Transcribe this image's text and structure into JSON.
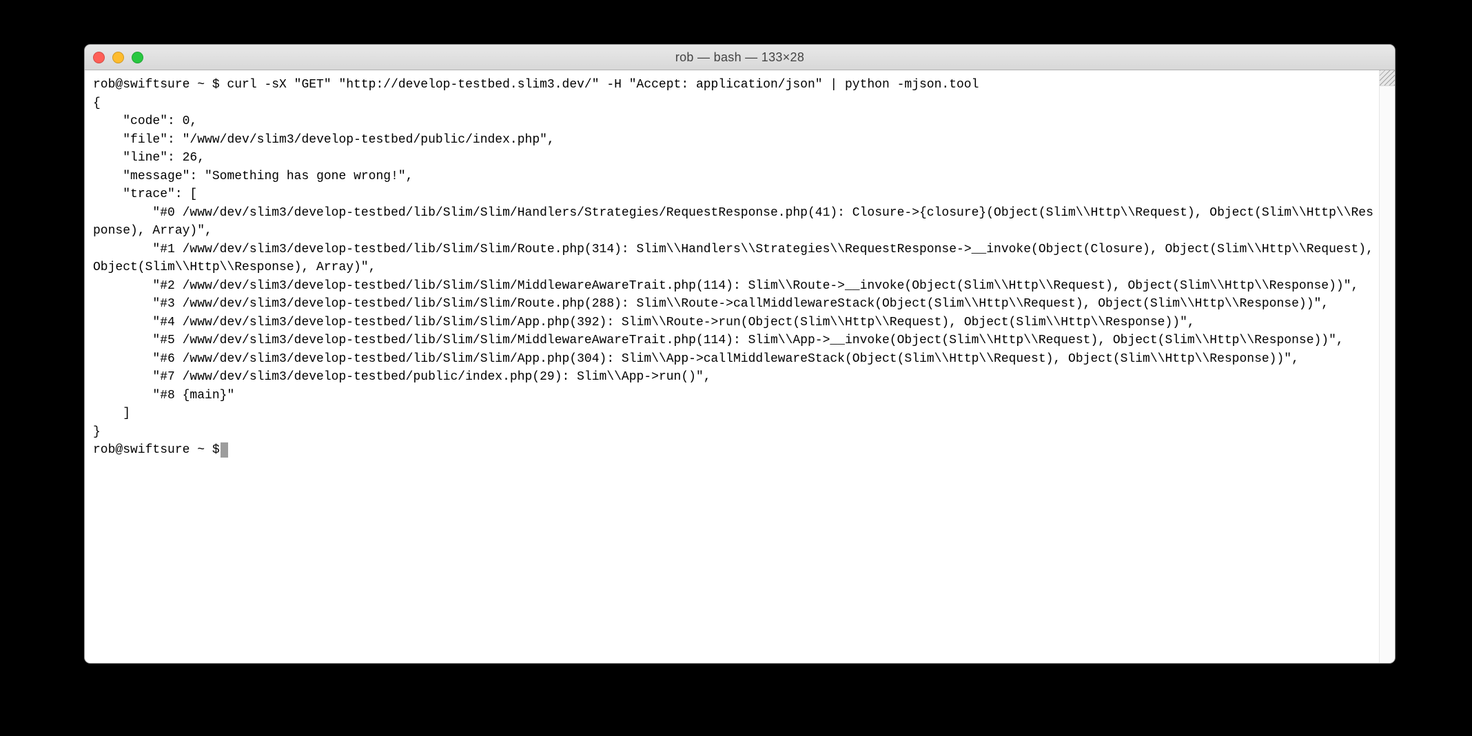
{
  "window": {
    "title": "rob — bash — 133×28"
  },
  "terminal": {
    "prompt1": "rob@swiftsure ~ $ curl -sX \"GET\" \"http://develop-testbed.slim3.dev/\" -H \"Accept: application/json\" | python -mjson.tool",
    "output": "{\n    \"code\": 0,\n    \"file\": \"/www/dev/slim3/develop-testbed/public/index.php\",\n    \"line\": 26,\n    \"message\": \"Something has gone wrong!\",\n    \"trace\": [\n        \"#0 /www/dev/slim3/develop-testbed/lib/Slim/Slim/Handlers/Strategies/RequestResponse.php(41): Closure->{closure}(Object(Slim\\\\Http\\\\Request), Object(Slim\\\\Http\\\\Response), Array)\",\n        \"#1 /www/dev/slim3/develop-testbed/lib/Slim/Slim/Route.php(314): Slim\\\\Handlers\\\\Strategies\\\\RequestResponse->__invoke(Object(Closure), Object(Slim\\\\Http\\\\Request), Object(Slim\\\\Http\\\\Response), Array)\",\n        \"#2 /www/dev/slim3/develop-testbed/lib/Slim/Slim/MiddlewareAwareTrait.php(114): Slim\\\\Route->__invoke(Object(Slim\\\\Http\\\\Request), Object(Slim\\\\Http\\\\Response))\",\n        \"#3 /www/dev/slim3/develop-testbed/lib/Slim/Slim/Route.php(288): Slim\\\\Route->callMiddlewareStack(Object(Slim\\\\Http\\\\Request), Object(Slim\\\\Http\\\\Response))\",\n        \"#4 /www/dev/slim3/develop-testbed/lib/Slim/Slim/App.php(392): Slim\\\\Route->run(Object(Slim\\\\Http\\\\Request), Object(Slim\\\\Http\\\\Response))\",\n        \"#5 /www/dev/slim3/develop-testbed/lib/Slim/Slim/MiddlewareAwareTrait.php(114): Slim\\\\App->__invoke(Object(Slim\\\\Http\\\\Request), Object(Slim\\\\Http\\\\Response))\",\n        \"#6 /www/dev/slim3/develop-testbed/lib/Slim/Slim/App.php(304): Slim\\\\App->callMiddlewareStack(Object(Slim\\\\Http\\\\Request), Object(Slim\\\\Http\\\\Response))\",\n        \"#7 /www/dev/slim3/develop-testbed/public/index.php(29): Slim\\\\App->run()\",\n        \"#8 {main}\"\n    ]\n}",
    "prompt2": "rob@swiftsure ~ $ "
  }
}
